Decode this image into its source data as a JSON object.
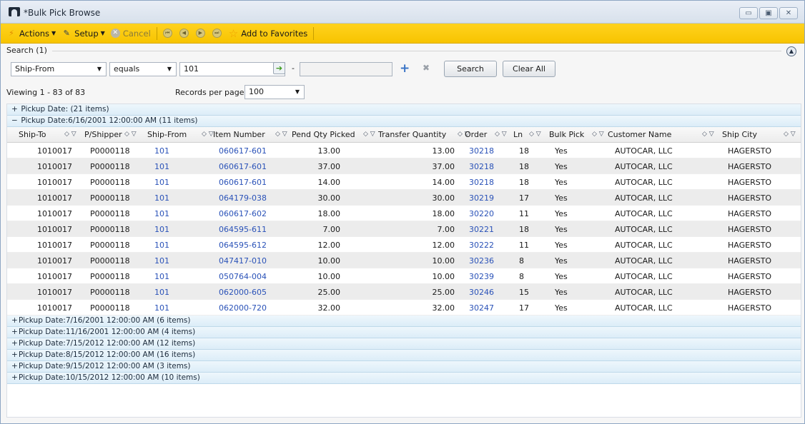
{
  "window": {
    "title": "*Bulk Pick Browse",
    "controls": {
      "minimize": "▭",
      "restore": "▣",
      "close": "✕"
    }
  },
  "toolbar": {
    "actions_label": "Actions",
    "setup_label": "Setup",
    "cancel_label": "Cancel",
    "favorites_label": "Add to Favorites"
  },
  "search": {
    "section_title": "Search (1)",
    "field": "Ship-From",
    "operator": "equals",
    "value": "101",
    "range_separator": "-",
    "range_value": "",
    "search_button": "Search",
    "clear_button": "Clear All"
  },
  "paging": {
    "viewing_text": "Viewing 1 - 83 of 83",
    "records_per_page_label": "Records per page:",
    "records_per_page_value": "100"
  },
  "grid": {
    "groups_before": [
      {
        "toggle": "+",
        "label": "Pickup Date: (21 items)"
      }
    ],
    "expanded_group": {
      "toggle": "−",
      "label": "Pickup Date:6/16/2001 12:00:00 AM (11 items)"
    },
    "columns": [
      "Ship-To",
      "P/Shipper",
      "Ship-From",
      "Item Number",
      "Pend Qty Picked",
      "Transfer Quantity",
      "Order",
      "Ln",
      "Bulk Pick",
      "Customer Name",
      "Ship City"
    ],
    "sort_filter_glyph": "◇ ▽",
    "rows": [
      [
        "1010017",
        "P0000118",
        "101",
        "060617-601",
        "13.00",
        "13.00",
        "30218",
        "18",
        "Yes",
        "AUTOCAR, LLC",
        "HAGERSTO"
      ],
      [
        "1010017",
        "P0000118",
        "101",
        "060617-601",
        "37.00",
        "37.00",
        "30218",
        "18",
        "Yes",
        "AUTOCAR, LLC",
        "HAGERSTO"
      ],
      [
        "1010017",
        "P0000118",
        "101",
        "060617-601",
        "14.00",
        "14.00",
        "30218",
        "18",
        "Yes",
        "AUTOCAR, LLC",
        "HAGERSTO"
      ],
      [
        "1010017",
        "P0000118",
        "101",
        "064179-038",
        "30.00",
        "30.00",
        "30219",
        "17",
        "Yes",
        "AUTOCAR, LLC",
        "HAGERSTO"
      ],
      [
        "1010017",
        "P0000118",
        "101",
        "060617-602",
        "18.00",
        "18.00",
        "30220",
        "11",
        "Yes",
        "AUTOCAR, LLC",
        "HAGERSTO"
      ],
      [
        "1010017",
        "P0000118",
        "101",
        "064595-611",
        "7.00",
        "7.00",
        "30221",
        "18",
        "Yes",
        "AUTOCAR, LLC",
        "HAGERSTO"
      ],
      [
        "1010017",
        "P0000118",
        "101",
        "064595-612",
        "12.00",
        "12.00",
        "30222",
        "11",
        "Yes",
        "AUTOCAR, LLC",
        "HAGERSTO"
      ],
      [
        "1010017",
        "P0000118",
        "101",
        "047417-010",
        "10.00",
        "10.00",
        "30236",
        "8",
        "Yes",
        "AUTOCAR, LLC",
        "HAGERSTO"
      ],
      [
        "1010017",
        "P0000118",
        "101",
        "050764-004",
        "10.00",
        "10.00",
        "30239",
        "8",
        "Yes",
        "AUTOCAR, LLC",
        "HAGERSTO"
      ],
      [
        "1010017",
        "P0000118",
        "101",
        "062000-605",
        "25.00",
        "25.00",
        "30246",
        "15",
        "Yes",
        "AUTOCAR, LLC",
        "HAGERSTO"
      ],
      [
        "1010017",
        "P0000118",
        "101",
        "062000-720",
        "32.00",
        "32.00",
        "30247",
        "17",
        "Yes",
        "AUTOCAR, LLC",
        "HAGERSTO"
      ]
    ],
    "groups_after": [
      {
        "toggle": "+",
        "label": "Pickup Date:7/16/2001 12:00:00 AM (6 items)"
      },
      {
        "toggle": "+",
        "label": "Pickup Date:11/16/2001 12:00:00 AM (4 items)"
      },
      {
        "toggle": "+",
        "label": "Pickup Date:7/15/2012 12:00:00 AM (12 items)"
      },
      {
        "toggle": "+",
        "label": "Pickup Date:8/15/2012 12:00:00 AM (16 items)"
      },
      {
        "toggle": "+",
        "label": "Pickup Date:9/15/2012 12:00:00 AM (3 items)"
      },
      {
        "toggle": "+",
        "label": "Pickup Date:10/15/2012 12:00:00 AM (10 items)"
      }
    ]
  },
  "colors": {
    "toolbar": "#f7c400",
    "link": "#2a52b8",
    "group_band": "#dcedf8",
    "alt_row": "#ececec"
  },
  "icons": [
    "app-icon",
    "lightning-icon",
    "pencil-icon",
    "cancel-icon",
    "first-page-icon",
    "prev-page-icon",
    "next-page-icon",
    "last-page-icon",
    "star-icon",
    "collapse-icon",
    "go-arrow-icon",
    "add-icon",
    "remove-icon"
  ]
}
